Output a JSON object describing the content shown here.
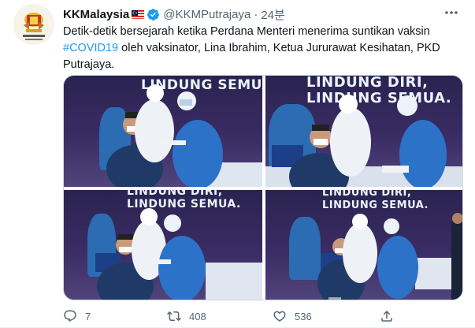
{
  "tweet": {
    "display_name": "KKMalaysia",
    "handle": "@KKMPutrajaya",
    "separator": "·",
    "time": "24분",
    "text_parts": {
      "line1": "Detik-detik bersejarah ketika Perdana Menteri menerima suntikan vaksin",
      "hashtag": "#COVID19",
      "line2": " oleh vaksinator, Lina Ibrahim, Ketua Jururawat Kesihatan, PKD",
      "line3": "Putrajaya."
    },
    "photos": [
      {
        "banner_top": "LINDUNG SEMUA."
      },
      {
        "banner_top": "LINDUNG DIRI,",
        "banner_bottom": "LINDUNG SEMUA."
      },
      {
        "banner_top": "LINDUNG DIRI,",
        "banner_bottom": "LINDUNG SEMUA."
      },
      {
        "banner_top": "LINDUNG DIRI,",
        "banner_bottom": "LINDUNG SEMUA."
      }
    ],
    "actions": {
      "replies": "7",
      "retweets": "408",
      "likes": "536"
    }
  },
  "icons": {
    "verified": "verified-badge-icon",
    "more": "more-options-icon",
    "reply": "reply-icon",
    "retweet": "retweet-icon",
    "like": "heart-icon",
    "share": "share-icon",
    "flag": "malaysia-flag-icon"
  },
  "colors": {
    "link": "#1d9bf0",
    "secondary_text": "#536471",
    "primary_text": "#0f1419",
    "verified": "#1d9bf0"
  }
}
